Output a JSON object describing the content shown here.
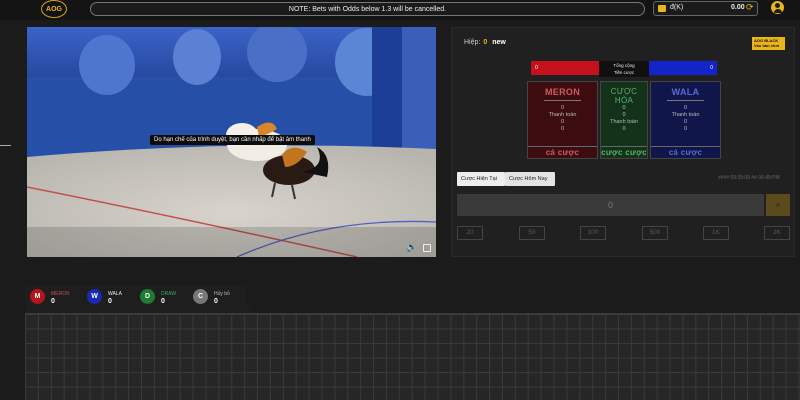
{
  "header": {
    "logo_text": "AOG",
    "notice": "NOTE: Bets with Odds below 1.3 will be cancelled.",
    "currency": "đ(K)",
    "balance": "0.00",
    "icons": [
      "wallet-icon",
      "refresh-icon",
      "user-icon"
    ],
    "accent_color": "#e8b51c"
  },
  "video": {
    "subtitle": "Do hạn chế của trình duyệt, bạn cần nhấp để bật âm thanh",
    "icons": [
      "mute-icon",
      "fullscreen-icon"
    ]
  },
  "betting": {
    "round_label": "Hiệp:",
    "round_number": "0",
    "round_status": "new",
    "badge_text": "AOG BLACK",
    "badge_sub": "Vào bàn chơi",
    "totals": {
      "meron_total": "0",
      "mid_line1": "Tổng cộng",
      "mid_line2": "Tiền cược",
      "wala_total": "0"
    },
    "boxes": [
      {
        "name": "MERON",
        "odds": "0",
        "payout_label": "Thanh toán",
        "payout": "0",
        "bet": "0",
        "button": "cá cược",
        "color": "#c4111c"
      },
      {
        "name": "CƯỢC HÒA",
        "odds": "0",
        "payout_label": "Thanh toán",
        "payout": "0",
        "bet": "0",
        "button": "cược cược",
        "color": "#1f7a32"
      },
      {
        "name": "WALA",
        "odds": "0",
        "payout_label": "Thanh toán",
        "payout": "0",
        "bet": "0",
        "button": "cá cược",
        "color": "#1424c8"
      }
    ],
    "tabs": [
      "Cược Hiện Tại",
      "Cược Hôm Nay"
    ],
    "record_time": "#### 09:29:09 ## 06:49:PM",
    "amount_value": "0",
    "clear_label": "×",
    "chips": [
      "20",
      "50",
      "100",
      "500",
      "1K",
      "2K"
    ]
  },
  "stats": [
    {
      "letter": "M",
      "label": "MERON",
      "count": "0",
      "color": "#b4141c",
      "label_color": "#d24a4a"
    },
    {
      "letter": "W",
      "label": "WALA",
      "count": "0",
      "color": "#1a2ab4",
      "label_color": "#eeeeee"
    },
    {
      "letter": "D",
      "label": "DRAW",
      "count": "0",
      "color": "#1f7a32",
      "label_color": "#3aa856"
    },
    {
      "letter": "C",
      "label": "Hủy bỏ",
      "count": "0",
      "color": "#777777",
      "label_color": "#bbbbbb"
    }
  ]
}
